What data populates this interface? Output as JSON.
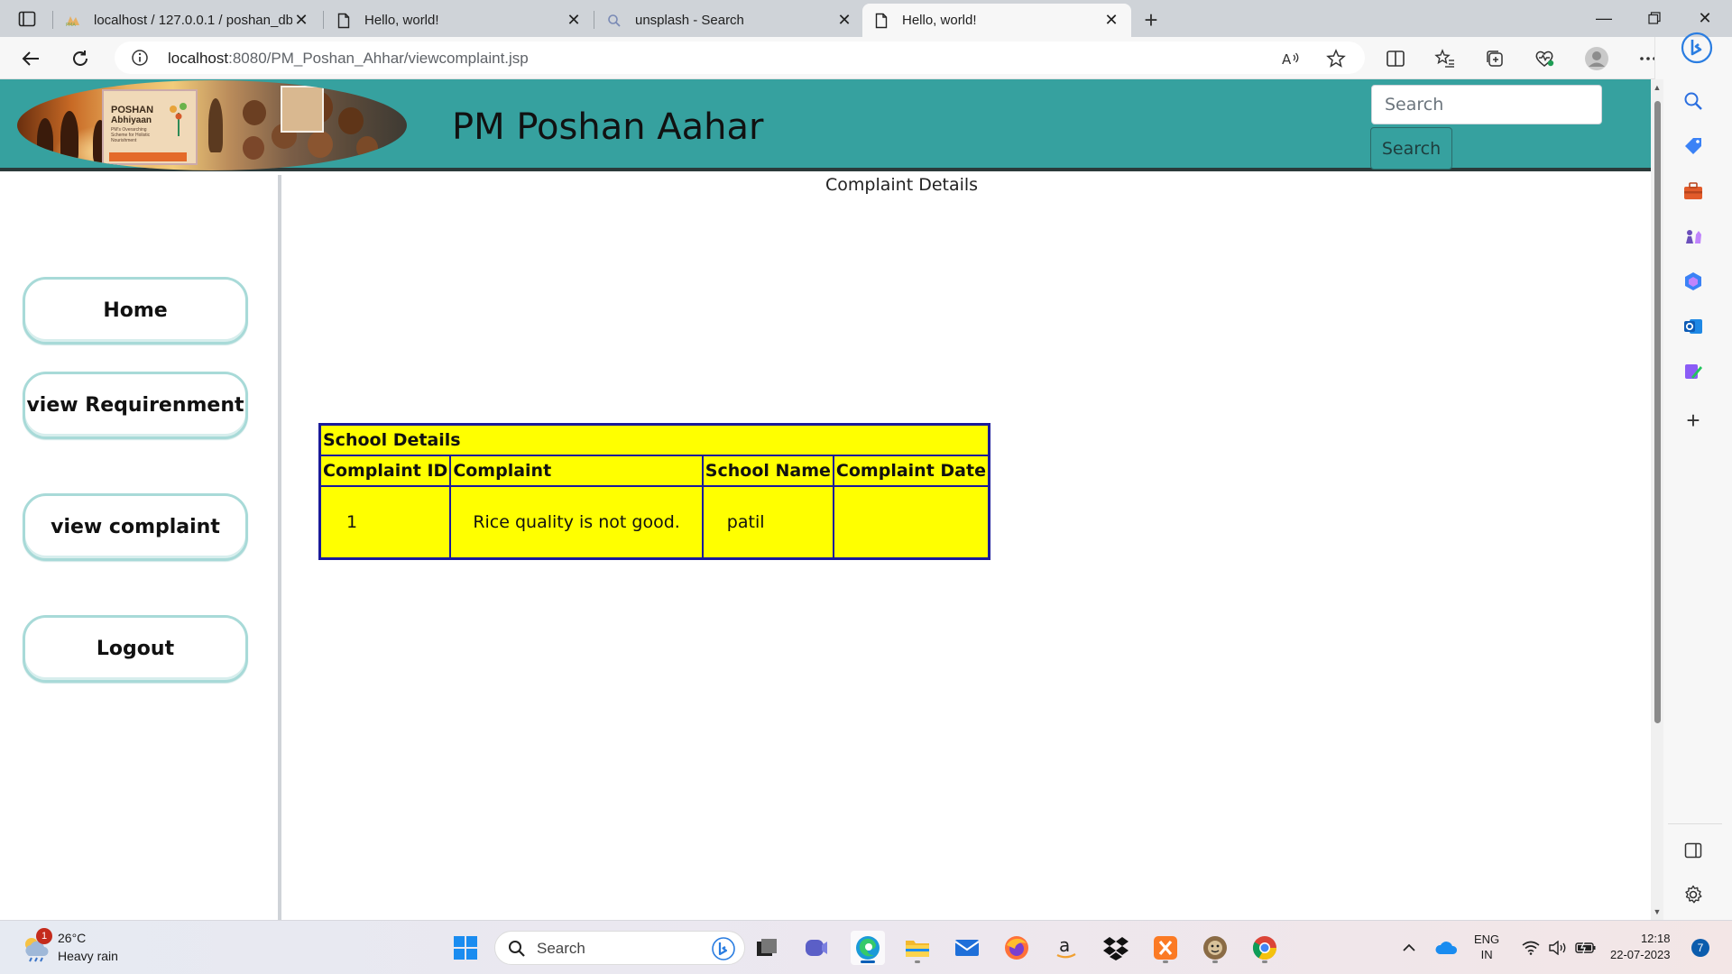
{
  "browser": {
    "tabs": [
      {
        "label": "localhost / 127.0.0.1 / poshan_db",
        "favicon": "phpmyadmin-icon",
        "active": false
      },
      {
        "label": "Hello, world!",
        "favicon": "page-icon",
        "active": false
      },
      {
        "label": "unsplash - Search",
        "favicon": "search-icon",
        "active": false
      },
      {
        "label": "Hello, world!",
        "favicon": "page-icon",
        "active": true
      }
    ],
    "url_host": "localhost",
    "url_path": ":8080/PM_Poshan_Ahhar/viewcomplaint.jsp"
  },
  "site": {
    "title": "PM Poshan Aahar",
    "search_placeholder": "Search",
    "search_button": "Search",
    "logo": {
      "line1": "POSHAN",
      "line2": "Abhiyaan",
      "line3": "PM's Overarching Scheme for Holistic Nourishment"
    }
  },
  "nav": {
    "home": "Home",
    "view_requirement": "view Requirenment",
    "view_complaint": "view complaint",
    "logout": "Logout"
  },
  "content": {
    "heading": "Complaint Details",
    "table": {
      "caption": "School Details",
      "headers": [
        "Complaint ID",
        "Complaint",
        "School Name",
        "Complaint Date"
      ],
      "rows": [
        {
          "id": "1",
          "complaint": "Rice quality is not good.",
          "school": "patil",
          "date": ""
        }
      ]
    }
  },
  "taskbar": {
    "weather_temp": "26°C",
    "weather_desc": "Heavy rain",
    "weather_badge": "1",
    "search_label": "Search",
    "lang_line1": "ENG",
    "lang_line2": "IN",
    "time": "12:18",
    "date": "22-07-2023",
    "notifications": "7"
  },
  "colors": {
    "header_teal": "#36a19f",
    "table_fill": "#ffff00",
    "table_border": "#1a1a9a",
    "nav_border": "#a8dad8"
  }
}
